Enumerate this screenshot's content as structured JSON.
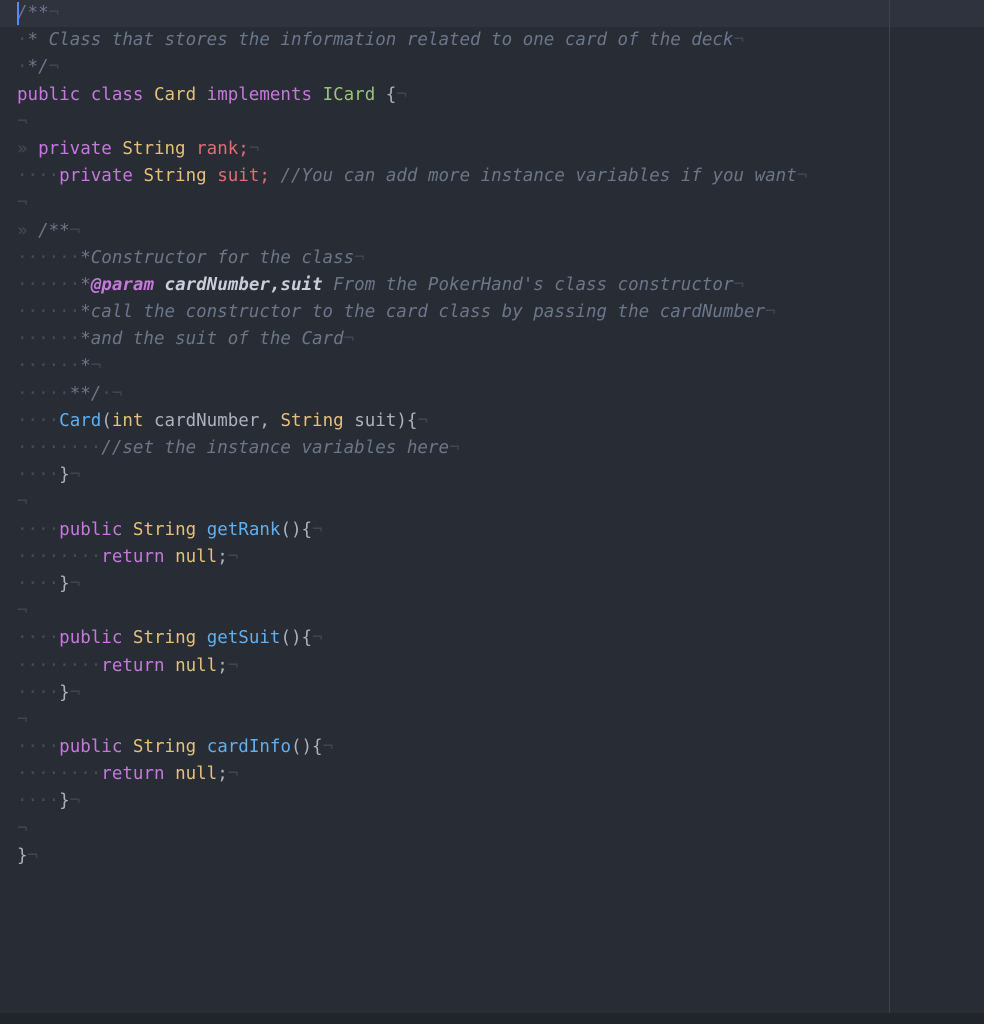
{
  "app": {
    "kind": "code-editor",
    "language": "Java",
    "theme": "dark",
    "colors": {
      "background": "#282c34",
      "current_line": "#2f333d",
      "bottom_bar": "#21252b",
      "ruler": "#3d434f",
      "caret": "#528bff",
      "keyword": "#c678dd",
      "type": "#e5c07b",
      "class_name": "#98c379",
      "function": "#61afef",
      "field": "#e06c75",
      "comment": "#6b7689",
      "doc_tag": "#c678dd",
      "doc_param": "#c8cedb",
      "plain": "#abb2bf",
      "whitespace_marker": "#454b57",
      "line_end_marker": "#3f4653"
    }
  },
  "markers": {
    "space": "·",
    "tab": "»",
    "line_end": "¬"
  },
  "caret": {
    "line": 1,
    "column": 1,
    "visible": true
  },
  "code": {
    "file_class": "Card",
    "interface": "ICard",
    "lines": [
      {
        "n": 1,
        "current": true,
        "tokens": [
          {
            "t": "/**",
            "c": "doc"
          },
          {
            "t": "¬",
            "c": "eol"
          }
        ]
      },
      {
        "n": 2,
        "tokens": [
          {
            "t": "·",
            "c": "ws"
          },
          {
            "t": "* Class that stores the information related to one card of the deck",
            "c": "doc"
          },
          {
            "t": "¬",
            "c": "eol"
          }
        ]
      },
      {
        "n": 3,
        "tokens": [
          {
            "t": "·",
            "c": "ws"
          },
          {
            "t": "*/",
            "c": "doc"
          },
          {
            "t": "¬",
            "c": "eol"
          }
        ]
      },
      {
        "n": 4,
        "tokens": [
          {
            "t": "public class ",
            "c": "kw"
          },
          {
            "t": "Card",
            "c": "type"
          },
          {
            "t": " implements ",
            "c": "kw"
          },
          {
            "t": "ICard",
            "c": "cls"
          },
          {
            "t": " {",
            "c": "plain"
          },
          {
            "t": "¬",
            "c": "eol"
          }
        ]
      },
      {
        "n": 5,
        "tokens": [
          {
            "t": "¬",
            "c": "eol"
          }
        ]
      },
      {
        "n": 6,
        "tokens": [
          {
            "t": "» ",
            "c": "tab"
          },
          {
            "t": "private ",
            "c": "kw"
          },
          {
            "t": "String",
            "c": "type"
          },
          {
            "t": " ",
            "c": "plain"
          },
          {
            "t": "rank",
            "c": "field"
          },
          {
            "t": ";",
            "c": "field"
          },
          {
            "t": "¬",
            "c": "eol"
          }
        ]
      },
      {
        "n": 7,
        "tokens": [
          {
            "t": "····",
            "c": "ws"
          },
          {
            "t": "private ",
            "c": "kw"
          },
          {
            "t": "String",
            "c": "type"
          },
          {
            "t": " ",
            "c": "plain"
          },
          {
            "t": "suit",
            "c": "field"
          },
          {
            "t": ";",
            "c": "field"
          },
          {
            "t": " ",
            "c": "plain"
          },
          {
            "t": "//You can add more instance variables if you want",
            "c": "cmt"
          },
          {
            "t": "¬",
            "c": "eol"
          }
        ]
      },
      {
        "n": 8,
        "tokens": [
          {
            "t": "¬",
            "c": "eol"
          }
        ]
      },
      {
        "n": 9,
        "tokens": [
          {
            "t": "» ",
            "c": "tab"
          },
          {
            "t": "/**",
            "c": "doc"
          },
          {
            "t": "¬",
            "c": "eol"
          }
        ]
      },
      {
        "n": 10,
        "tokens": [
          {
            "t": "······",
            "c": "ws"
          },
          {
            "t": "*Constructor for the class",
            "c": "doc"
          },
          {
            "t": "¬",
            "c": "eol"
          }
        ]
      },
      {
        "n": 11,
        "tokens": [
          {
            "t": "······",
            "c": "ws"
          },
          {
            "t": "*",
            "c": "doc"
          },
          {
            "t": "@param",
            "c": "doctag"
          },
          {
            "t": " ",
            "c": "doc"
          },
          {
            "t": "cardNumber,suit",
            "c": "docparam"
          },
          {
            "t": " From the PokerHand's class constructor",
            "c": "doc"
          },
          {
            "t": "¬",
            "c": "eol"
          }
        ]
      },
      {
        "n": 12,
        "tokens": [
          {
            "t": "······",
            "c": "ws"
          },
          {
            "t": "*call the constructor to the card class by passing the cardNumber",
            "c": "doc"
          },
          {
            "t": "¬",
            "c": "eol"
          }
        ]
      },
      {
        "n": 13,
        "tokens": [
          {
            "t": "······",
            "c": "ws"
          },
          {
            "t": "*and the suit of the Card",
            "c": "doc"
          },
          {
            "t": "¬",
            "c": "eol"
          }
        ]
      },
      {
        "n": 14,
        "tokens": [
          {
            "t": "······",
            "c": "ws"
          },
          {
            "t": "*",
            "c": "doc"
          },
          {
            "t": "¬",
            "c": "eol"
          }
        ]
      },
      {
        "n": 15,
        "tokens": [
          {
            "t": "·····",
            "c": "ws"
          },
          {
            "t": "**/",
            "c": "doc"
          },
          {
            "t": "·",
            "c": "ws"
          },
          {
            "t": "¬",
            "c": "eol"
          }
        ]
      },
      {
        "n": 16,
        "tokens": [
          {
            "t": "····",
            "c": "ws"
          },
          {
            "t": "Card",
            "c": "fn"
          },
          {
            "t": "(",
            "c": "plain"
          },
          {
            "t": "int",
            "c": "type"
          },
          {
            "t": " cardNumber, ",
            "c": "plain"
          },
          {
            "t": "String",
            "c": "type"
          },
          {
            "t": " suit){",
            "c": "plain"
          },
          {
            "t": "¬",
            "c": "eol"
          }
        ]
      },
      {
        "n": 17,
        "tokens": [
          {
            "t": "········",
            "c": "ws"
          },
          {
            "t": "//set the instance variables here",
            "c": "cmt"
          },
          {
            "t": "¬",
            "c": "eol"
          }
        ]
      },
      {
        "n": 18,
        "tokens": [
          {
            "t": "····",
            "c": "ws"
          },
          {
            "t": "}",
            "c": "plain"
          },
          {
            "t": "¬",
            "c": "eol"
          }
        ]
      },
      {
        "n": 19,
        "tokens": [
          {
            "t": "¬",
            "c": "eol"
          }
        ]
      },
      {
        "n": 20,
        "tokens": [
          {
            "t": "····",
            "c": "ws"
          },
          {
            "t": "public ",
            "c": "kw"
          },
          {
            "t": "String",
            "c": "type"
          },
          {
            "t": " ",
            "c": "plain"
          },
          {
            "t": "getRank",
            "c": "fn"
          },
          {
            "t": "(){",
            "c": "plain"
          },
          {
            "t": "¬",
            "c": "eol"
          }
        ]
      },
      {
        "n": 21,
        "tokens": [
          {
            "t": "········",
            "c": "ws"
          },
          {
            "t": "return ",
            "c": "kw"
          },
          {
            "t": "null",
            "c": "type"
          },
          {
            "t": ";",
            "c": "plain"
          },
          {
            "t": "¬",
            "c": "eol"
          }
        ]
      },
      {
        "n": 22,
        "tokens": [
          {
            "t": "····",
            "c": "ws"
          },
          {
            "t": "}",
            "c": "plain"
          },
          {
            "t": "¬",
            "c": "eol"
          }
        ]
      },
      {
        "n": 23,
        "tokens": [
          {
            "t": "¬",
            "c": "eol"
          }
        ]
      },
      {
        "n": 24,
        "tokens": [
          {
            "t": "····",
            "c": "ws"
          },
          {
            "t": "public ",
            "c": "kw"
          },
          {
            "t": "String",
            "c": "type"
          },
          {
            "t": " ",
            "c": "plain"
          },
          {
            "t": "getSuit",
            "c": "fn"
          },
          {
            "t": "(){",
            "c": "plain"
          },
          {
            "t": "¬",
            "c": "eol"
          }
        ]
      },
      {
        "n": 25,
        "tokens": [
          {
            "t": "········",
            "c": "ws"
          },
          {
            "t": "return ",
            "c": "kw"
          },
          {
            "t": "null",
            "c": "type"
          },
          {
            "t": ";",
            "c": "plain"
          },
          {
            "t": "¬",
            "c": "eol"
          }
        ]
      },
      {
        "n": 26,
        "tokens": [
          {
            "t": "····",
            "c": "ws"
          },
          {
            "t": "}",
            "c": "plain"
          },
          {
            "t": "¬",
            "c": "eol"
          }
        ]
      },
      {
        "n": 27,
        "tokens": [
          {
            "t": "¬",
            "c": "eol"
          }
        ]
      },
      {
        "n": 28,
        "tokens": [
          {
            "t": "····",
            "c": "ws"
          },
          {
            "t": "public ",
            "c": "kw"
          },
          {
            "t": "String",
            "c": "type"
          },
          {
            "t": " ",
            "c": "plain"
          },
          {
            "t": "cardInfo",
            "c": "fn"
          },
          {
            "t": "(){",
            "c": "plain"
          },
          {
            "t": "¬",
            "c": "eol"
          }
        ]
      },
      {
        "n": 29,
        "tokens": [
          {
            "t": "········",
            "c": "ws"
          },
          {
            "t": "return ",
            "c": "kw"
          },
          {
            "t": "null",
            "c": "type"
          },
          {
            "t": ";",
            "c": "plain"
          },
          {
            "t": "¬",
            "c": "eol"
          }
        ]
      },
      {
        "n": 30,
        "tokens": [
          {
            "t": "····",
            "c": "ws"
          },
          {
            "t": "}",
            "c": "plain"
          },
          {
            "t": "¬",
            "c": "eol"
          }
        ]
      },
      {
        "n": 31,
        "tokens": [
          {
            "t": "¬",
            "c": "eol"
          }
        ]
      },
      {
        "n": 32,
        "tokens": [
          {
            "t": "}",
            "c": "plain"
          },
          {
            "t": "¬",
            "c": "eol"
          }
        ]
      }
    ]
  }
}
